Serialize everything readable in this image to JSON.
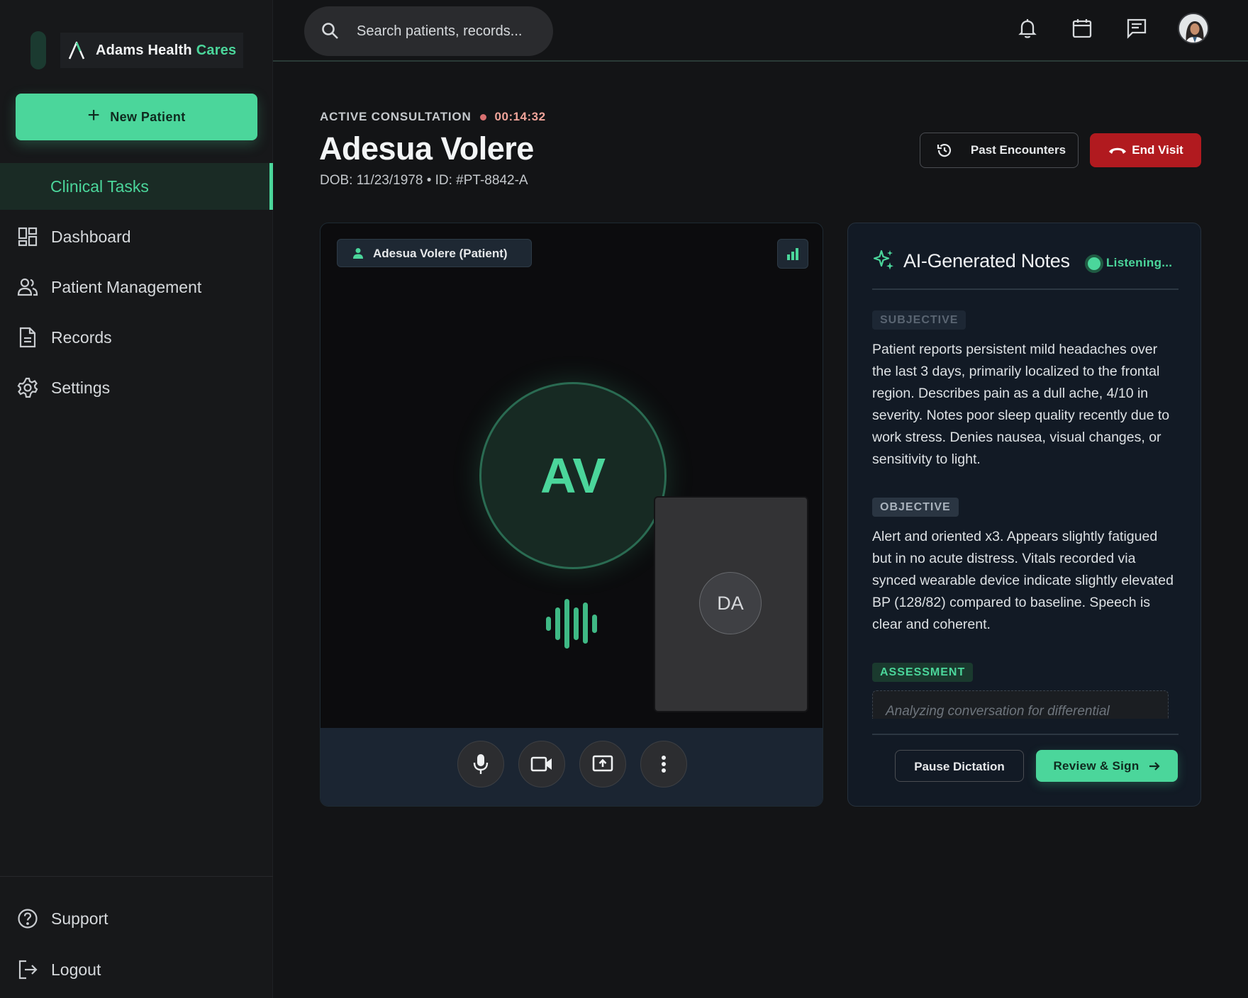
{
  "brand": {
    "name": "Adams Health",
    "accent_word": "Cares",
    "accent_color": "#4bd69b"
  },
  "sidebar": {
    "new_patient_label": "New Patient",
    "items": [
      {
        "label": "Clinical Tasks",
        "icon": "clinical-tasks",
        "active": true
      },
      {
        "label": "Dashboard",
        "icon": "dashboard-icon"
      },
      {
        "label": "Patient Management",
        "icon": "users-icon"
      },
      {
        "label": "Records",
        "icon": "document-icon"
      },
      {
        "label": "Settings",
        "icon": "gear-icon"
      }
    ],
    "bottom": [
      {
        "label": "Support",
        "icon": "help-icon"
      },
      {
        "label": "Logout",
        "icon": "logout-icon"
      }
    ]
  },
  "topbar": {
    "search_placeholder": "Search patients, records...",
    "icons": [
      "bell-icon",
      "calendar-icon",
      "chat-icon",
      "user-avatar"
    ]
  },
  "consultation": {
    "status": "ACTIVE CONSULTATION",
    "timer": "00:14:32",
    "patient_name": "Adesua Volere",
    "meta": "DOB: 11/23/1978 • ID: #PT-8842-A",
    "past_label": "Past Encounters",
    "end_label": "End Visit",
    "end_color": "#b11a1f"
  },
  "video": {
    "tag": "Adesua Volere (Patient)",
    "patient_initials": "AV",
    "self_initials": "DA",
    "controls": [
      "microphone-icon",
      "camera-icon",
      "screen-share-icon",
      "more-vertical-icon"
    ]
  },
  "notes": {
    "title": "AI-Generated Notes",
    "status": "Listening...",
    "subjective_label": "SUBJECTIVE",
    "subjective_text": "Patient reports persistent mild headaches over the last 3 days, primarily localized to the frontal region. Describes pain as a dull ache, 4/10 in severity. Notes poor sleep quality recently due to work stress. Denies nausea, visual changes, or sensitivity to light.",
    "objective_label": "OBJECTIVE",
    "objective_text": "Alert and oriented x3. Appears slightly fatigued but in no acute distress. Vitals recorded via synced wearable device indicate slightly elevated BP (128/82) compared to baseline. Speech is clear and coherent.",
    "assessment_label": "ASSESSMENT",
    "assessment_placeholder": "Analyzing conversation for differential",
    "pause_label": "Pause Dictation",
    "review_label": "Review & Sign"
  }
}
